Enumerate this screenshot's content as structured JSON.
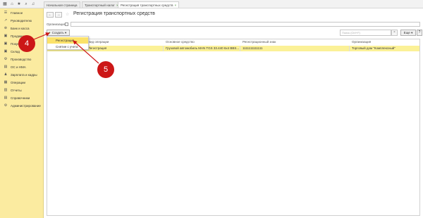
{
  "topbar": {
    "icons": [
      "apps-icon",
      "home-icon",
      "star-icon",
      "search-icon",
      "bell-icon"
    ]
  },
  "tabs": [
    {
      "label": "Начальная страница"
    },
    {
      "label": "Транспортный налог",
      "close": "×"
    },
    {
      "label": "Регистрация транспортных средств",
      "close": "×"
    }
  ],
  "sidebar": {
    "items": [
      {
        "icon": "☰",
        "label": "Главное"
      },
      {
        "icon": "↗",
        "label": "Руководителю"
      },
      {
        "icon": "⊕",
        "label": "Банк и касса"
      },
      {
        "icon": "▣",
        "label": "Продажи"
      },
      {
        "icon": "▣",
        "label": "Покупки"
      },
      {
        "icon": "▣",
        "label": "Склад"
      },
      {
        "icon": "⚙",
        "label": "Производство"
      },
      {
        "icon": "▤",
        "label": "ОС и НМА"
      },
      {
        "icon": "♟",
        "label": "Зарплата и кадры"
      },
      {
        "icon": "▦",
        "label": "Операции"
      },
      {
        "icon": "▥",
        "label": "Отчеты"
      },
      {
        "icon": "▤",
        "label": "Справочники"
      },
      {
        "icon": "⚙",
        "label": "Администрирование"
      }
    ]
  },
  "header": {
    "back": "←",
    "forward": "→",
    "star": "☆",
    "title": "Регистрация транспортных средств"
  },
  "filter": {
    "label": "Организация:"
  },
  "toolbar": {
    "create_label": "Создать",
    "create_caret": "▾",
    "search_placeholder": "Поиск (Ctrl+F)",
    "search_clear": "×",
    "more_label": "Еще ▾",
    "help_label": "?"
  },
  "dropdown": {
    "items": [
      {
        "label": "Регистрация"
      },
      {
        "label": "Снятие с учета"
      }
    ]
  },
  "table": {
    "headers": [
      "Вид операции",
      "Основное средство",
      "Регистрационный знак",
      "Организация"
    ],
    "rows": [
      {
        "cells": [
          "Регистрация",
          "Грузовой автомобиль MAN TGS 33.440 6x4 BBS...",
          "1111111111111",
          "Торговый дом \"Комплексный\""
        ]
      }
    ]
  },
  "annotations": [
    {
      "label": "4"
    },
    {
      "label": "5"
    }
  ],
  "colors": {
    "sidebar_bg": "#fbeba0",
    "row_highlight": "#fbf197",
    "dropdown_selected": "#fbe26a",
    "annotation": "#cc1717"
  }
}
